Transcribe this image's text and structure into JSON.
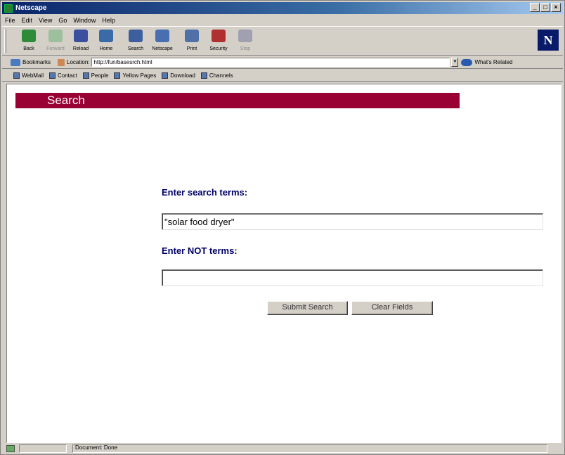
{
  "window": {
    "title": "Netscape",
    "buttons": [
      "_",
      "□",
      "×"
    ]
  },
  "menu": [
    "File",
    "Edit",
    "View",
    "Go",
    "Window",
    "Help"
  ],
  "toolbar": {
    "buttons": [
      {
        "label": "Back",
        "icon": "back-arrow-icon",
        "color": "#2e8b3a",
        "enabled": true
      },
      {
        "label": "Forward",
        "icon": "forward-arrow-icon",
        "color": "#9dbf9d",
        "enabled": false
      },
      {
        "label": "Reload",
        "icon": "reload-icon",
        "color": "#3a4f9e",
        "enabled": true
      },
      {
        "label": "Home",
        "icon": "home-icon",
        "color": "#3a6aa8",
        "enabled": true
      },
      {
        "label": "Search",
        "icon": "search-icon",
        "color": "#3d5f9e",
        "enabled": true
      },
      {
        "label": "Netscape",
        "icon": "netscape-icon",
        "color": "#4a6fb0",
        "enabled": true
      },
      {
        "label": "Print",
        "icon": "print-icon",
        "color": "#5070a8",
        "enabled": true
      },
      {
        "label": "Security",
        "icon": "lock-icon",
        "color": "#b03030",
        "enabled": true
      },
      {
        "label": "Stop",
        "icon": "stop-icon",
        "color": "#a0a0b0",
        "enabled": false
      }
    ]
  },
  "location": {
    "bookmarks_label": "Bookmarks",
    "location_label": "Location:",
    "url": "http://fun/basesrch.html",
    "related_label": "What's Related"
  },
  "personal_toolbar": [
    "WebMail",
    "Contact",
    "People",
    "Yellow Pages",
    "Download",
    "Channels"
  ],
  "page": {
    "banner_title": "Search",
    "search_label": "Enter search terms:",
    "search_value": "\"solar food dryer\"",
    "not_label": "Enter NOT terms:",
    "not_value": "",
    "submit_label": "Submit Search",
    "clear_label": "Clear Fields"
  },
  "status": {
    "text": "Document: Done"
  },
  "colors": {
    "banner": "#990033",
    "label": "#000066",
    "page_bg": "#ffffff"
  }
}
